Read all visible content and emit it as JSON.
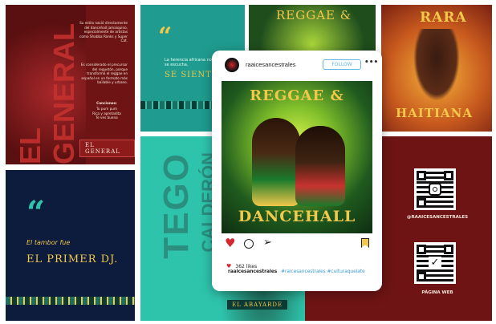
{
  "colors": {
    "maroon": "#7a1717",
    "gold": "#f1c84a",
    "navy": "#0d1b3d",
    "teal": "#1f9c8f",
    "turquoise": "#2ec4ac",
    "lime": "#cfe63a",
    "red": "#d3262e"
  },
  "panel_general": {
    "vertical_text": "EL GENERAL",
    "para1": "Su estilo nació directamente del dancehall jamaiquino, especialmente de artistas como Shabba Ranks y Super Cat.",
    "para2": "Es considerado el precursor del reguetón, porque transformó el reggae en español en un formato más bailable y urbano.",
    "songs_title": "Canciones:",
    "songs": "Tu pum pum\nRica y apretadita\nTe ves buena",
    "tag": "EL GENERAL"
  },
  "panel_herencia": {
    "quote_mark": "“",
    "line": "La herencia africana no se escucha,",
    "highlight": "SE SIENTE"
  },
  "panel_reggae_top": {
    "title": "REGGAE &"
  },
  "panel_rara": {
    "title_top": "RARA",
    "title_bottom": "HAITIANA"
  },
  "panel_tambor": {
    "quote_mark": "“",
    "line": "El tambor fue",
    "highlight": "EL PRIMER DJ."
  },
  "panel_tego": {
    "vertical1": "TEGO",
    "vertical2": "CALDERÓN",
    "tag": "EL ABAYARDE"
  },
  "panel_qr": {
    "handle": "@RAAICESANCESTRALES",
    "web": "PÁGINA WEB"
  },
  "post": {
    "username": "raaicesancestrales",
    "follow_label": "FOLLOW",
    "more_icon": "more-dots-icon",
    "image_title_top": "REGGAE &",
    "image_title_bottom": "DANCEHALL",
    "likes": "362 likes",
    "caption_user": "raaicesancestrales",
    "caption_tags": "#raicesancestrales #culturaquelate"
  }
}
